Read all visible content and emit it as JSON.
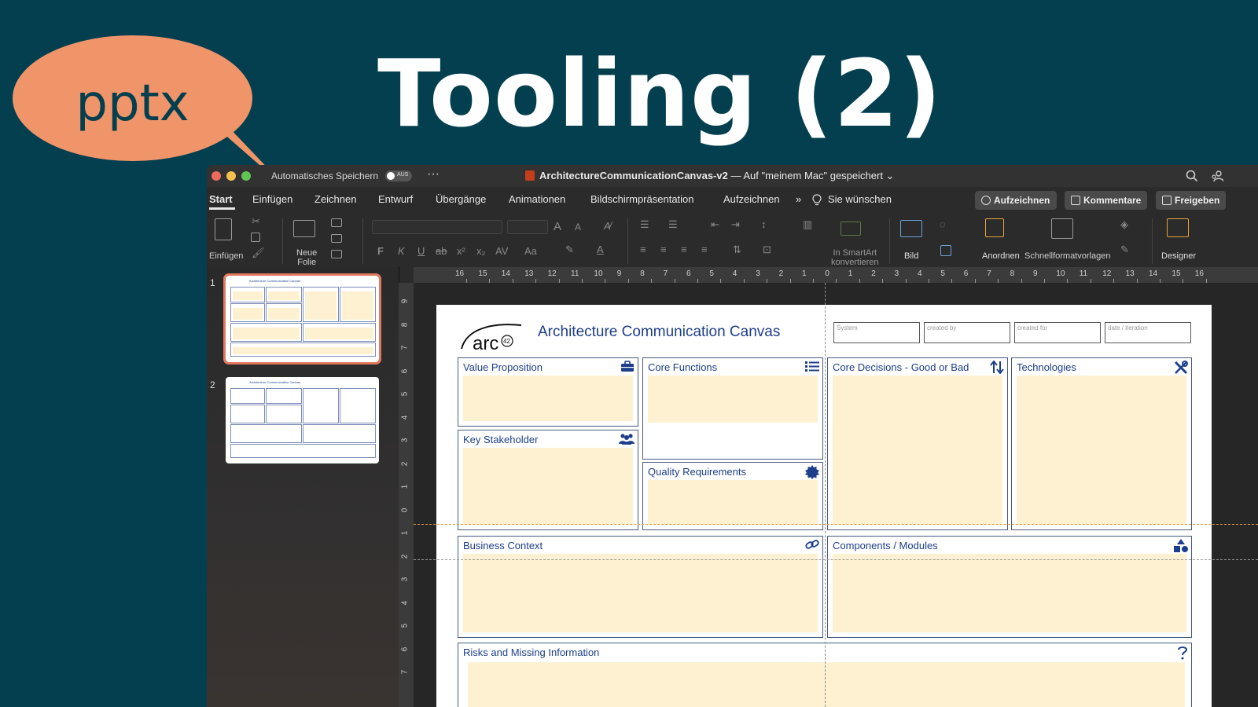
{
  "slide": {
    "title": "Tooling (2)",
    "bubble_text": "pptx"
  },
  "window": {
    "autosave_label": "Automatisches Speichern",
    "autosave_state": "AUS",
    "more": "···",
    "doc_name": "ArchitectureCommunicationCanvas-v2",
    "doc_location": " — Auf \"meinem Mac\" gespeichert ⌄"
  },
  "tabs": [
    "Start",
    "Einfügen",
    "Zeichnen",
    "Entwurf",
    "Übergänge",
    "Animationen",
    "Bildschirmpräsentation",
    "Aufzeichnen"
  ],
  "tell_me": "Sie wünschen",
  "overflow": "»",
  "actions": {
    "record": "Aufzeichnen",
    "comments": "Kommentare",
    "share": "Freigeben"
  },
  "ribbon": {
    "paste": "Einfügen",
    "new_slide_line1": "Neue",
    "new_slide_line2": "Folie",
    "smartart_line1": "In SmartArt",
    "smartart_line2": "konvertieren",
    "picture": "Bild",
    "arrange": "Anordnen",
    "quick_styles": "Schnellformatvorlagen",
    "designer": "Designer",
    "bold": "F",
    "italic": "K",
    "underline": "U",
    "strike": "ab",
    "superscript": "x²",
    "subscript": "x₂",
    "spacing": "AV",
    "case": "Aa",
    "grow": "A",
    "shrink": "A"
  },
  "thumbnails": [
    {
      "number": "1",
      "title": "Architecture Communication Canvas"
    },
    {
      "number": "2",
      "title": "Architecture Communication Canvas"
    }
  ],
  "ruler": {
    "horizontal": [
      "16",
      "15",
      "14",
      "13",
      "12",
      "11",
      "10",
      "9",
      "8",
      "7",
      "6",
      "5",
      "4",
      "3",
      "2",
      "1",
      "0",
      "1",
      "2",
      "3",
      "4",
      "5",
      "6",
      "7",
      "8",
      "9",
      "10",
      "11",
      "12",
      "13",
      "14",
      "15",
      "16"
    ],
    "vertical": [
      "9",
      "8",
      "7",
      "6",
      "5",
      "4",
      "3",
      "2",
      "1",
      "0",
      "1",
      "2",
      "3",
      "4",
      "5",
      "6",
      "7"
    ]
  },
  "canvas": {
    "logo_text": "arc",
    "logo_sup": "42",
    "title": "Architecture Communication Canvas",
    "meta": [
      "System",
      "created by",
      "created for",
      "date / iteration"
    ],
    "cells": {
      "value_proposition": "Value Proposition",
      "key_stakeholder": "Key Stakeholder",
      "core_functions": "Core Functions",
      "quality_requirements": "Quality Requirements",
      "core_decisions": "Core Decisions - Good or Bad",
      "technologies": "Technologies",
      "business_context": "Business Context",
      "components_modules": "Components / Modules",
      "risks": "Risks and Missing Information"
    }
  },
  "colors": {
    "background": "#033f4e",
    "bubble": "#f0946a",
    "canvas_text": "#1d3e8a",
    "cell_fill": "#fdf1d2",
    "selection": "#e2795f"
  },
  "icons": {
    "value_proposition": "briefcase-icon",
    "key_stakeholder": "people-icon",
    "core_functions": "list-icon",
    "quality_requirements": "badge-icon",
    "core_decisions": "up-down-arrows-icon",
    "technologies": "tools-icon",
    "business_context": "link-icon",
    "components_modules": "shapes-icon",
    "risks": "question-icon"
  }
}
